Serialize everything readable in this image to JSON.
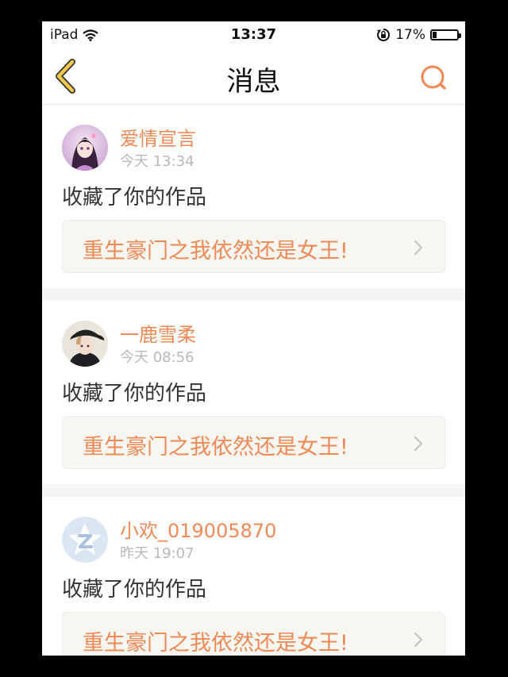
{
  "status_bar": {
    "device": "iPad",
    "time": "13:37",
    "battery_text": "17%",
    "battery_level": 0.17,
    "icons": [
      "wifi-icon",
      "orientation-lock-icon",
      "battery-icon"
    ]
  },
  "nav": {
    "title": "消息",
    "back_icon": "chevron-left-icon",
    "search_icon": "search-icon",
    "accent_color": "#ef8a56",
    "back_color": "#f2c94c"
  },
  "messages": [
    {
      "username": "爱情宣言",
      "time": "今天 13:34",
      "action": "收藏了你的作品",
      "work_title": "重生豪门之我依然还是女王!",
      "avatar": "anime-girl-avatar"
    },
    {
      "username": "一鹿雪柔",
      "time": "今天 08:56",
      "action": "收藏了你的作品",
      "work_title": "重生豪门之我依然还是女王!",
      "avatar": "boy-with-cap-avatar"
    },
    {
      "username": "小欢_019005870",
      "time": "昨天 19:07",
      "action": "收藏了你的作品",
      "work_title": "重生豪门之我依然还是女王!",
      "avatar": "default-z-avatar"
    }
  ]
}
